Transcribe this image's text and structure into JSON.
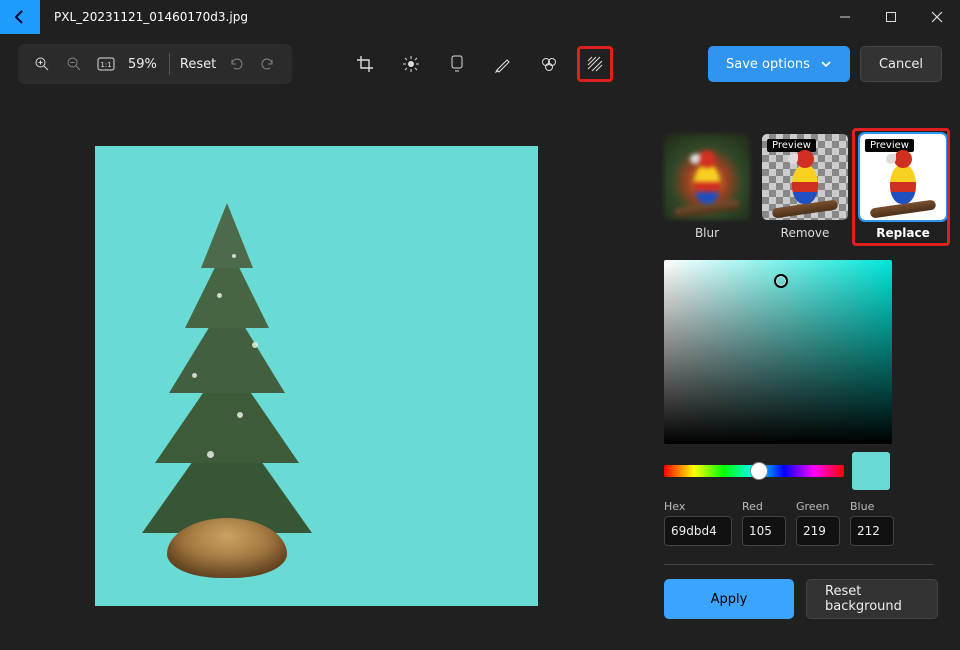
{
  "window": {
    "filename": "PXL_20231121_01460170d3.jpg"
  },
  "toolbar": {
    "zoom_percent": "59%",
    "reset_label": "Reset"
  },
  "header_buttons": {
    "save_options": "Save options",
    "cancel": "Cancel"
  },
  "bg_options": {
    "items": [
      {
        "key": "blur",
        "label": "Blur",
        "preview_tag": null
      },
      {
        "key": "remove",
        "label": "Remove",
        "preview_tag": "Preview"
      },
      {
        "key": "replace",
        "label": "Replace",
        "preview_tag": "Preview"
      }
    ],
    "selected": "replace"
  },
  "color": {
    "hex_label": "Hex",
    "red_label": "Red",
    "green_label": "Green",
    "blue_label": "Blue",
    "hex": "69dbd4",
    "red": "105",
    "green": "219",
    "blue": "212"
  },
  "actions": {
    "apply": "Apply",
    "reset_bg": "Reset background"
  }
}
